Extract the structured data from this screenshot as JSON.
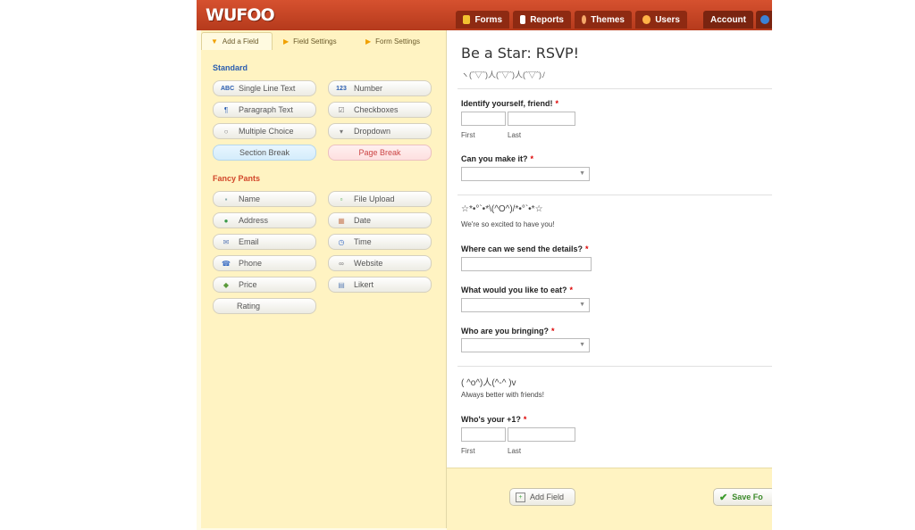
{
  "header": {
    "logo": "WUFOO",
    "nav": [
      {
        "label": "Forms",
        "color": "#f2c230"
      },
      {
        "label": "Reports",
        "color": "#ffffff"
      },
      {
        "label": "Themes",
        "color": "#f5a86a"
      },
      {
        "label": "Users",
        "color": "#ffb347"
      },
      {
        "label": "Account",
        "color": ""
      }
    ]
  },
  "left": {
    "tabs": [
      "Add a Field",
      "Field Settings",
      "Form Settings"
    ],
    "standard_title": "Standard",
    "fancy_title": "Fancy Pants",
    "standard": [
      {
        "label": "Single Line Text",
        "icon": "ABC"
      },
      {
        "label": "Number",
        "icon": "123"
      },
      {
        "label": "Paragraph Text",
        "icon": "¶"
      },
      {
        "label": "Checkboxes",
        "icon": "☑"
      },
      {
        "label": "Multiple Choice",
        "icon": "○"
      },
      {
        "label": "Dropdown",
        "icon": "▾"
      },
      {
        "label": "Section Break",
        "icon": ""
      },
      {
        "label": "Page Break",
        "icon": ""
      }
    ],
    "fancy": [
      {
        "label": "Name",
        "icon": "▪"
      },
      {
        "label": "File Upload",
        "icon": "▫"
      },
      {
        "label": "Address",
        "icon": "●"
      },
      {
        "label": "Date",
        "icon": "▦"
      },
      {
        "label": "Email",
        "icon": "✉"
      },
      {
        "label": "Time",
        "icon": "◷"
      },
      {
        "label": "Phone",
        "icon": "☎"
      },
      {
        "label": "Website",
        "icon": "∞"
      },
      {
        "label": "Price",
        "icon": "◆"
      },
      {
        "label": "Likert",
        "icon": "▤"
      },
      {
        "label": "Rating",
        "icon": ""
      }
    ]
  },
  "form": {
    "title": "Be a Star: RSVP!",
    "subtitle": "ヽ(ˆ▽ˆ)人(ˆ▽ˆ)人(ˆ▽ˆ)ﾉ",
    "identify_label": "Identify yourself, friend!",
    "first": "First",
    "last": "Last",
    "make_it_label": "Can you make it?",
    "section1_title": "☆*•°`•*\\(^O^)/*•°`•*☆",
    "section1_desc": "We're so excited to have you!",
    "details_label": "Where can we send the details?",
    "eat_label": "What would you like to eat?",
    "bringing_label": "Who are you bringing?",
    "section2_title": "( ^o^)人(^-^ )v",
    "section2_desc": "Always better with friends!",
    "plus_one_label": "Who's your +1?",
    "required_mark": "*"
  },
  "bottom": {
    "add_field": "Add Field",
    "save_form": "Save Fo"
  }
}
